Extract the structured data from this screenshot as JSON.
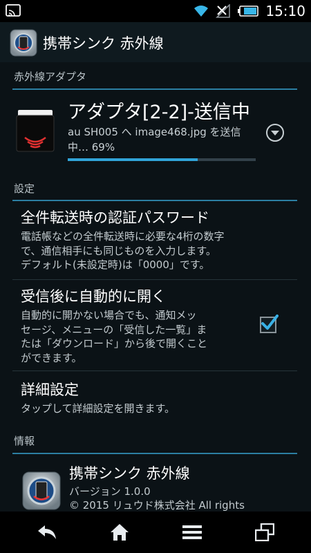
{
  "status_bar": {
    "time": "15:10"
  },
  "app_bar": {
    "title": "携帯シンク 赤外線"
  },
  "adapter_section": {
    "header": "赤外線アダプタ",
    "title": "アダプタ[2-2]-送信中",
    "subtitle": "au SH005 へ image468.jpg を送信中… 69%",
    "progress": 0.69
  },
  "settings_section": {
    "header": "設定",
    "items": [
      {
        "title": "全件転送時の認証パスワード",
        "desc_lines": [
          "電話帳などの全件転送時に必要な4桁の数字",
          "で、通信相手にも同じものを入力します。",
          "デフォルト(未設定時)は「0000」です。"
        ]
      },
      {
        "title": "受信後に自動的に開く",
        "desc_lines": [
          "自動的に開かない場合でも、通知メッ",
          "セージ、メニューの「受信した一覧」ま",
          "たは「ダウンロード」から後で開くこと",
          "ができます。"
        ],
        "checked": true
      },
      {
        "title": "詳細設定",
        "desc_lines": [
          "タップして詳細設定を開きます。"
        ]
      }
    ]
  },
  "info_section": {
    "header": "情報",
    "title": "携帯シンク 赤外線",
    "version": "バージョン 1.0.0",
    "copyright": "© 2015 リュウド株式会社 All rights"
  },
  "nav_bar": {
    "icons": [
      "back-icon",
      "home-icon",
      "menu-icon",
      "recent-apps-icon"
    ]
  }
}
